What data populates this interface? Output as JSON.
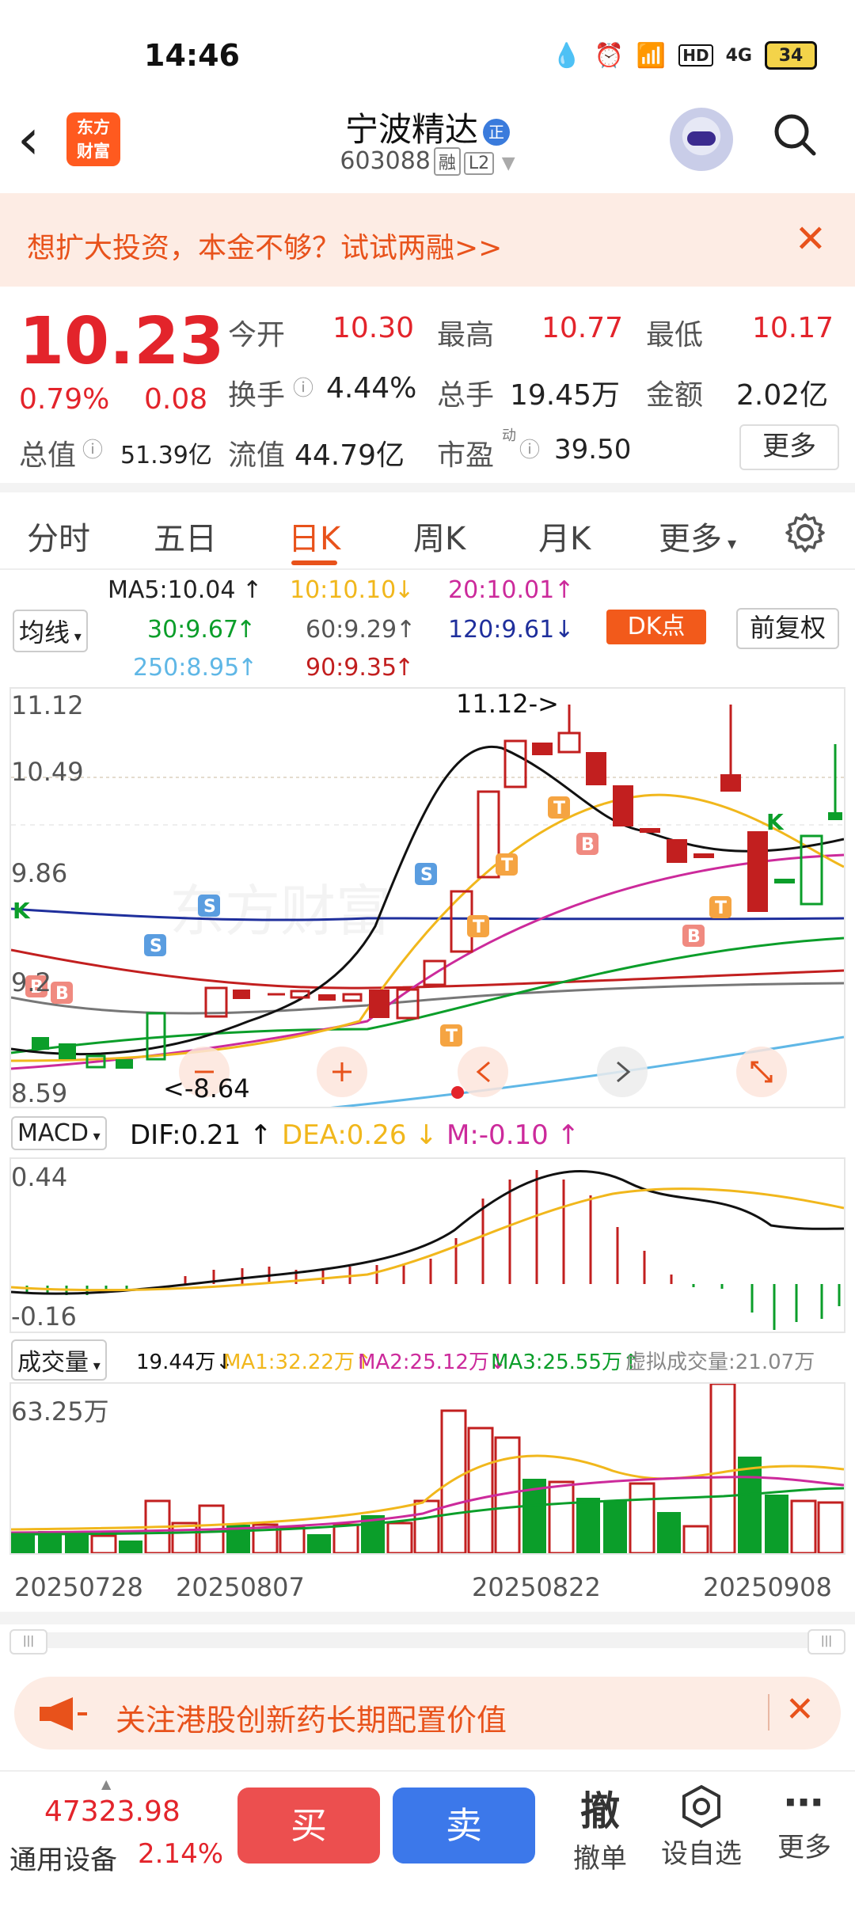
{
  "status_bar": {
    "time": "14:46",
    "battery": "34",
    "network": "4G",
    "hd": "HD"
  },
  "header": {
    "stock_name": "宁波精达",
    "badge": "正",
    "stock_code": "603088",
    "tag_rong": "融",
    "tag_level": "L2",
    "logo_line1": "东方",
    "logo_line2": "财富"
  },
  "banner": {
    "text": "想扩大投资，本金不够？试试两融>>"
  },
  "quote": {
    "price": "10.23",
    "change_pct": "0.79%",
    "change": "0.08",
    "open_label": "今开",
    "open": "10.30",
    "high_label": "最高",
    "high": "10.77",
    "low_label": "最低",
    "low": "10.17",
    "turnover_label": "换手",
    "turnover": "4.44%",
    "volume_label": "总手",
    "volume": "19.45万",
    "amount_label": "金额",
    "amount": "2.02亿",
    "mktcap_label": "总值",
    "mktcap": "51.39亿",
    "float_label": "流值",
    "float_cap": "44.79亿",
    "pe_label": "市盈",
    "pe_super": "动",
    "pe": "39.50",
    "more_label": "更多"
  },
  "tabs": [
    "分时",
    "五日",
    "日K",
    "周K",
    "月K",
    "更多"
  ],
  "active_tab": "日K",
  "ma_bar": {
    "selector": "均线",
    "ma5": "MA5:10.04",
    "ma10": "10:10.10",
    "ma20": "20:10.01",
    "ma30": "30:9.67",
    "ma60": "60:9.29",
    "ma120": "120:9.61",
    "ma250": "250:8.95",
    "ma90": "90:9.35",
    "dk_label": "DK点",
    "fq_label": "前复权"
  },
  "kline": {
    "y_labels": [
      "11.12",
      "10.49",
      "9.86",
      "9.2",
      "8.59"
    ],
    "max_label": "11.12->",
    "min_label": "<-8.64",
    "watermark": "东方财富"
  },
  "macd": {
    "selector": "MACD",
    "dif": "DIF:0.21",
    "dea": "DEA:0.26",
    "m": "M:-0.10",
    "y_top": "0.44",
    "y_bottom": "-0.16"
  },
  "volume": {
    "selector": "成交量",
    "current": "19.44万",
    "ma1": "MA1:32.22万",
    "ma2": "MA2:25.12万",
    "ma3": "MA3:25.55万",
    "virtual": "虚拟成交量:21.07万",
    "y_top": "63.25万",
    "dates": [
      "20250728",
      "20250807",
      "20250822",
      "20250908"
    ]
  },
  "notice": {
    "text": "关注港股创新药长期配置价值"
  },
  "bottom": {
    "index_value": "47323.98",
    "index_name": "通用设备",
    "index_change": "2.14%",
    "buy": "买",
    "sell": "卖",
    "cancel_icon": "撤",
    "cancel": "撤单",
    "watch": "设自选",
    "more": "更多"
  },
  "colors": {
    "up": "#e3242b",
    "down": "#0b9e2a",
    "accent": "#e8521b",
    "blue": "#3c78ea"
  }
}
